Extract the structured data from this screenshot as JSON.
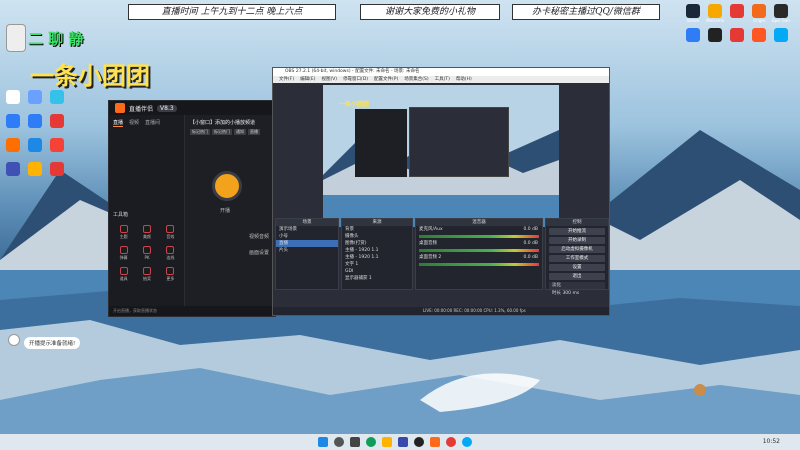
{
  "banners": [
    "直播时间 上午九到十二点 晚上六点",
    "谢谢大家免费的小礼物",
    "办卡秘密主播过QQ/微信群"
  ],
  "overlay": {
    "line1": "二  聊  静",
    "line2": "一条小团团"
  },
  "desktop_left_icons": [
    {
      "label": "",
      "color": "#ffffff"
    },
    {
      "label": "",
      "color": "#6aa0ff"
    },
    {
      "label": "",
      "color": "#35c1e8"
    },
    {
      "label": "",
      "color": "#2e7cf6"
    },
    {
      "label": "",
      "color": "#2e7cf6"
    },
    {
      "label": "",
      "color": "#e53935"
    },
    {
      "label": "",
      "color": "#ff6f00"
    },
    {
      "label": "",
      "color": "#1e88e5"
    },
    {
      "label": "",
      "color": "#f44336"
    },
    {
      "label": "",
      "color": "#3f51b5"
    },
    {
      "label": "",
      "color": "#ffb300"
    },
    {
      "label": "",
      "color": "#e53935"
    }
  ],
  "desktop_right_icons": [
    {
      "label": "Steam",
      "color": "#1b2838"
    },
    {
      "label": "WeGame",
      "color": "#f6a700"
    },
    {
      "label": "",
      "color": "#e53935"
    },
    {
      "label": "Origin",
      "color": "#f26b1d"
    },
    {
      "label": "Epic Games",
      "color": "#2a2a2a"
    },
    {
      "label": "",
      "color": "#2e7cf6"
    },
    {
      "label": "",
      "color": "#222222"
    },
    {
      "label": "",
      "color": "#e53935"
    },
    {
      "label": "",
      "color": "#ff5722"
    },
    {
      "label": "",
      "color": "#03a9f4"
    }
  ],
  "zb_window": {
    "title": "直播伴侣",
    "badge": "V8.3",
    "tabs": [
      "直播",
      "视频",
      "直播间"
    ],
    "tools_header": "工具箱",
    "tools": [
      "主题",
      "美颜",
      "音效",
      "弹幕",
      "PK",
      "连线",
      "道具",
      "抽奖",
      "更多"
    ],
    "right_title": "【小窗口】添加的小播放频道",
    "tags": [
      "标记热门",
      "标记热门",
      "通知",
      "直播"
    ],
    "center_text": "开播",
    "side_labels": [
      "视频音频",
      "画面设置"
    ],
    "footer": "开启直播，获取直播状态"
  },
  "obs": {
    "title": "OBS 27.2.1 (64-bit, windows) - 配置文件: 未命名 - 场景: 未命名",
    "menus": [
      "文件(F)",
      "编辑(E)",
      "视图(V)",
      "停靠窗口(D)",
      "配置文件(P)",
      "场景集合(S)",
      "工具(T)",
      "帮助(H)"
    ],
    "docks": {
      "scenes": {
        "header": "场景",
        "items": [
          "演示场景",
          "小号",
          "直播",
          "片头"
        ]
      },
      "sources": {
        "header": "来源",
        "items": [
          "背景",
          "摄像头",
          "图像(打赏)",
          "主播 - 1920 1.1",
          "主播 - 1920 1.1",
          "文字 1",
          "GDI",
          "显示器捕获 1"
        ]
      },
      "mixer": {
        "header": "混音器",
        "tracks": [
          {
            "name": "麦克风/Aux",
            "db": "0.0 dB"
          },
          {
            "name": "桌面音频",
            "db": "0.0 dB"
          },
          {
            "name": "桌面音频 2",
            "db": "0.0 dB"
          }
        ]
      },
      "controls": {
        "header": "控制",
        "buttons": [
          "开始推流",
          "开始录制",
          "启动虚拟摄像机",
          "工作室模式",
          "设置",
          "退出"
        ]
      },
      "transitions": {
        "label": "淡化",
        "duration_label": "时长",
        "duration": "300 ms"
      }
    },
    "status": "LIVE: 00:00:00   REC: 00:00:00   CPU: 1.3%, 60.00 fps"
  },
  "notice": "开播提示准备就绪!",
  "tray_time": "10:52"
}
